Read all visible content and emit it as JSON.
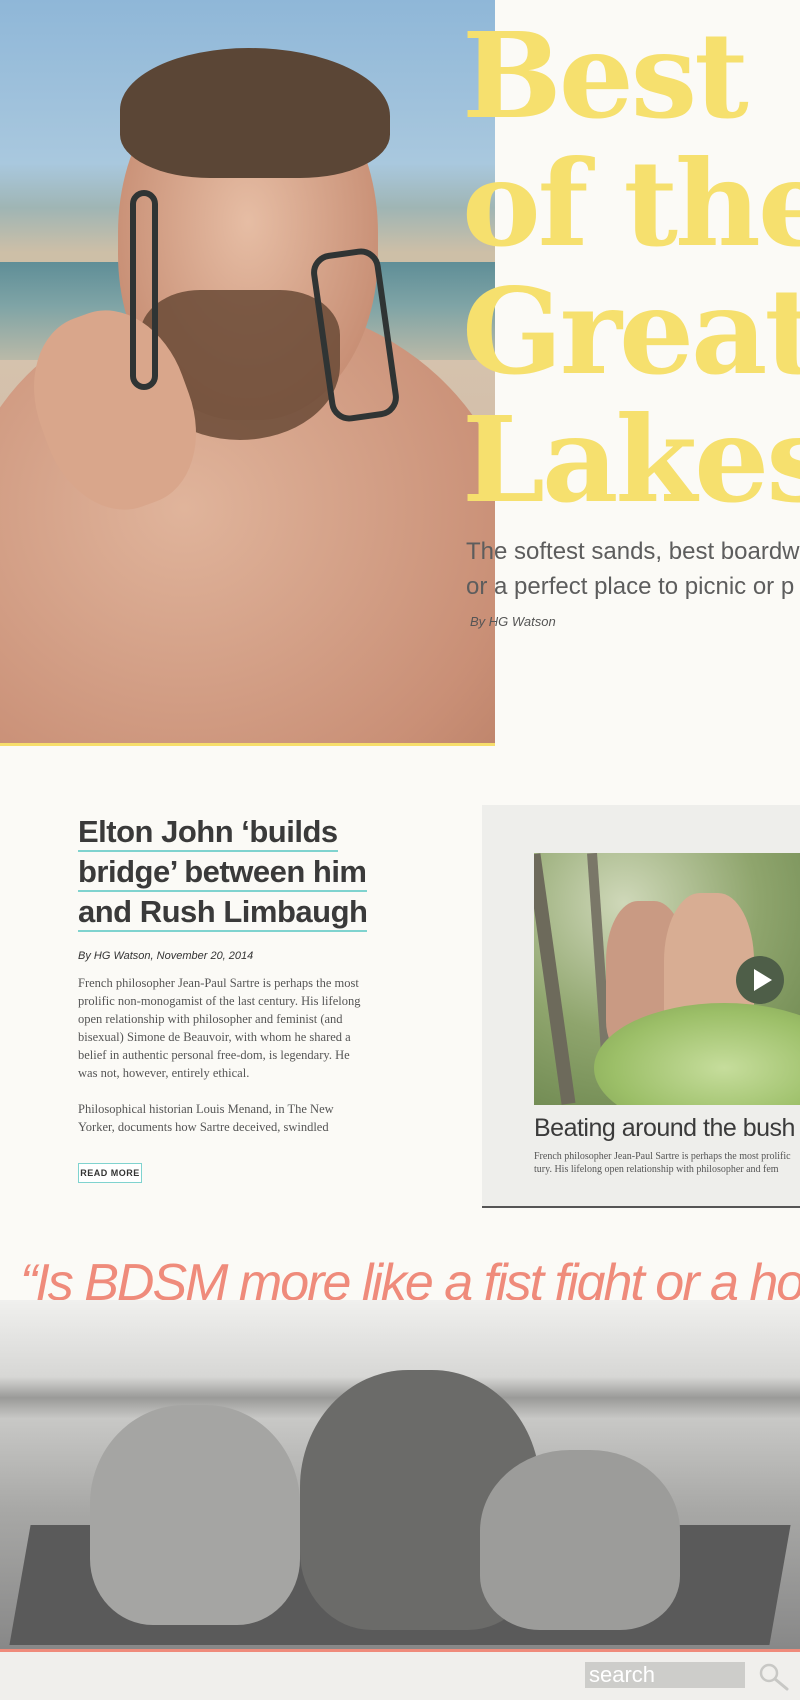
{
  "hero": {
    "image_alt": "",
    "title_lines": [
      "Best",
      "of the",
      "Great",
      "Lakes"
    ],
    "subtitle_lines": [
      "The softest sands, best boardwalk",
      "or a perfect place to picnic or p"
    ],
    "byline": "By HG Watson",
    "accent_color": "#f6e06e"
  },
  "article": {
    "title": "Elton John ‘builds bridge’ between him and Rush Limbaugh",
    "byline": "By HG Watson, November 20, 2014",
    "paragraphs": [
      "French philosopher Jean-Paul Sartre is perhaps the most prolific non-monogamist of the last century. His lifelong open relationship with philosopher and feminist (and bisexual) Simone de Beauvoir, with whom he shared a belief in authentic personal free-dom, is legendary. He was not, however, entirely ethical.",
      "Philosophical historian Louis Menand, in The New Yorker, documents how Sartre deceived, swindled"
    ],
    "read_more_label": "READ MORE",
    "underline_color": "#7fd3cf"
  },
  "video_card": {
    "title": "Beating around the bush",
    "desc_lines": [
      "French philosopher Jean-Paul Sartre is perhaps the most prolific",
      "tury. His lifelong open relationship with philosopher and fem"
    ],
    "play_icon": "play-icon"
  },
  "quote": {
    "text": "“Is BDSM more like a fist fight or a hockey fig",
    "color": "#ef8b7b"
  },
  "footer": {
    "search_placeholder": "search",
    "search_icon": "search-icon"
  }
}
